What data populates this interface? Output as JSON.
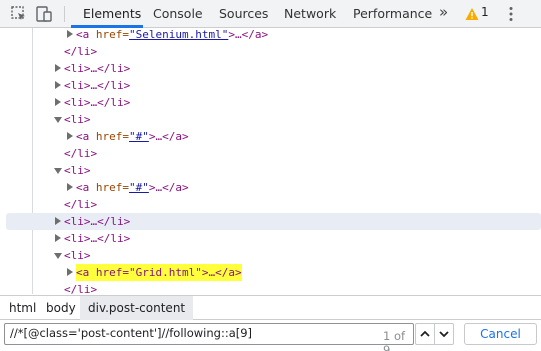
{
  "toolbar": {
    "tabs": [
      {
        "label": "Elements"
      },
      {
        "label": "Console"
      },
      {
        "label": "Sources"
      },
      {
        "label": "Network"
      },
      {
        "label": "Performance"
      }
    ],
    "more_label": "»",
    "warning_count": "1",
    "accent_color": "#1a73e8"
  },
  "tree": {
    "ellipsis": "…",
    "rows": [
      {
        "open": "<a ",
        "attr": "href=",
        "val": "\"Selenium.html\"",
        "close": ">…</a>"
      },
      {
        "text": "</li>"
      },
      {
        "text": "<li>…</li>"
      },
      {
        "text": "<li>…</li>"
      },
      {
        "text": "<li>…</li>"
      },
      {
        "text": "<li>"
      },
      {
        "open": "<a ",
        "attr": "href=",
        "val": "\"#\"",
        "close": ">…</a>"
      },
      {
        "text": "</li>"
      },
      {
        "text": "<li>"
      },
      {
        "open": "<a ",
        "attr": "href=",
        "val": "\"#\"",
        "close": ">…</a>"
      },
      {
        "text": "</li>"
      },
      {
        "text": "<li>…</li>"
      },
      {
        "text": "<li>…</li>"
      },
      {
        "text": "<li>"
      },
      {
        "text": "<a href=\"Grid.html\">…</a>"
      },
      {
        "text": "</li>"
      }
    ]
  },
  "breadcrumb": {
    "items": [
      "html",
      "body",
      "div.post-content"
    ]
  },
  "search": {
    "value": "//*[@class='post-content']//following::a[9]",
    "match_count": "1 of 9",
    "cancel_label": "Cancel"
  }
}
